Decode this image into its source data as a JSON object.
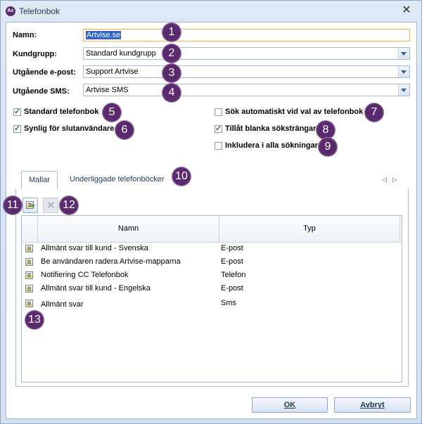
{
  "window": {
    "title": "Telefonbok",
    "app_icon": "Ac"
  },
  "form": {
    "name_label": "Namn:",
    "name_value": "Artvise.se",
    "customer_group_label": "Kundgrupp:",
    "customer_group_value": "Standard kundgrupp",
    "outgoing_email_label": "Utgående e-post:",
    "outgoing_email_value": "Support Artvise",
    "outgoing_sms_label": "Utgående SMS:",
    "outgoing_sms_value": "Artvise SMS"
  },
  "checkboxes": {
    "standard_phonebook": {
      "label": "Standard telefonbok",
      "checked": true
    },
    "visible_end_users": {
      "label": "Synlig för slutanvändare",
      "checked": true
    },
    "auto_search": {
      "label": "Sök automatiskt vid val av telefonbok",
      "checked": false
    },
    "allow_blank": {
      "label": "Tillåt blanka söksträngar",
      "checked": true
    },
    "include_all": {
      "label": "Inkludera i alla sökningar",
      "checked": false
    }
  },
  "tabs": [
    {
      "label": "Mallar",
      "active": true
    },
    {
      "label": "Underliggade telefonböcker",
      "active": false
    }
  ],
  "grid": {
    "columns": [
      "Namn",
      "Typ"
    ],
    "rows": [
      {
        "name": "Allmänt svar till kund - Svenska",
        "type": "E-post"
      },
      {
        "name": "Be användaren radera Artvise-mapparna",
        "type": "E-post"
      },
      {
        "name": "Notifiering CC Telefonbok",
        "type": "Telefon"
      },
      {
        "name": "Allmänt svar till kund - Engelska",
        "type": "E-post"
      },
      {
        "name": "Allmänt svar",
        "type": "Sms"
      }
    ]
  },
  "buttons": {
    "ok": "OK",
    "cancel": "Avbryt"
  },
  "badges": [
    "1",
    "2",
    "3",
    "4",
    "5",
    "6",
    "7",
    "8",
    "9",
    "10",
    "11",
    "12",
    "13"
  ],
  "colors": {
    "badge": "#5b2a6e",
    "selection": "#3163c5",
    "focus_border": "#f0b34a"
  }
}
